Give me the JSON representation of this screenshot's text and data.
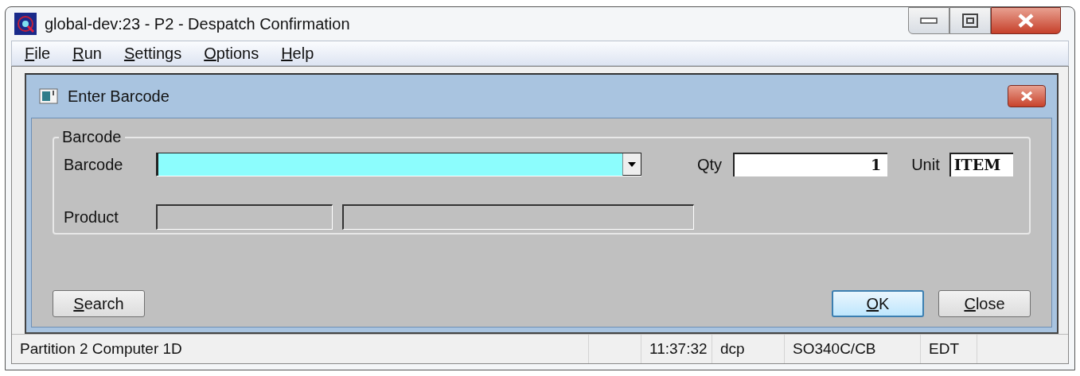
{
  "window": {
    "title": "global-dev:23 - P2 - Despatch Confirmation"
  },
  "menu": [
    {
      "label": "File"
    },
    {
      "label": "Run"
    },
    {
      "label": "Settings"
    },
    {
      "label": "Options"
    },
    {
      "label": "Help"
    }
  ],
  "dialog": {
    "title": "Enter Barcode",
    "group": {
      "title": "Barcode",
      "barcode": {
        "label": "Barcode",
        "focused": true
      },
      "qty": {
        "label": "Qty",
        "value": "1"
      },
      "unit": {
        "label": "Unit",
        "value": "ITEM"
      },
      "product": {
        "label": "Product"
      }
    },
    "buttons": [
      {
        "label": "Search",
        "default": false
      },
      {
        "label": "OK",
        "default": true
      },
      {
        "label": "Close",
        "default": false
      }
    ]
  },
  "status_bar": {
    "message": "Partition 2 Computer 1D",
    "time": "11:37:32",
    "user": "dcp",
    "program": "SO340C/CB",
    "mode": "EDT"
  }
}
